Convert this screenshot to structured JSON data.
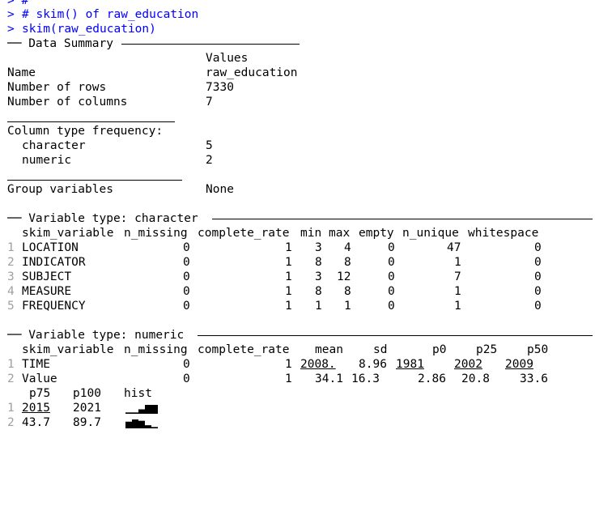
{
  "console": {
    "prompt": ">",
    "line0_partial": "> #",
    "comment": "# skim() of raw_education",
    "command": "skim(raw_education)"
  },
  "summary": {
    "header": "── Data Summary",
    "values_header": "Values",
    "rows": [
      {
        "label": "Name",
        "value": "raw_education"
      },
      {
        "label": "Number of rows",
        "value": "7330"
      },
      {
        "label": "Number of columns",
        "value": "7"
      }
    ],
    "col_type_title": "Column type frequency:",
    "col_types": [
      {
        "label": "character",
        "value": "5"
      },
      {
        "label": "numeric",
        "value": "2"
      }
    ],
    "group_label": "Group variables",
    "group_value": "None"
  },
  "character_section": {
    "header": "── Variable type: character",
    "columns": [
      "skim_variable",
      "n_missing",
      "complete_rate",
      "min",
      "max",
      "empty",
      "n_unique",
      "whitespace"
    ],
    "rows": [
      {
        "idx": "1",
        "skim_variable": "LOCATION",
        "n_missing": "0",
        "complete_rate": "1",
        "min": "3",
        "max": "4",
        "empty": "0",
        "n_unique": "47",
        "whitespace": "0"
      },
      {
        "idx": "2",
        "skim_variable": "INDICATOR",
        "n_missing": "0",
        "complete_rate": "1",
        "min": "8",
        "max": "8",
        "empty": "0",
        "n_unique": "1",
        "whitespace": "0"
      },
      {
        "idx": "3",
        "skim_variable": "SUBJECT",
        "n_missing": "0",
        "complete_rate": "1",
        "min": "3",
        "max": "12",
        "empty": "0",
        "n_unique": "7",
        "whitespace": "0"
      },
      {
        "idx": "4",
        "skim_variable": "MEASURE",
        "n_missing": "0",
        "complete_rate": "1",
        "min": "8",
        "max": "8",
        "empty": "0",
        "n_unique": "1",
        "whitespace": "0"
      },
      {
        "idx": "5",
        "skim_variable": "FREQUENCY",
        "n_missing": "0",
        "complete_rate": "1",
        "min": "1",
        "max": "1",
        "empty": "0",
        "n_unique": "1",
        "whitespace": "0"
      }
    ]
  },
  "numeric_section": {
    "header": "── Variable type: numeric",
    "columns": [
      "skim_variable",
      "n_missing",
      "complete_rate",
      "mean",
      "sd",
      "p0",
      "p25",
      "p50"
    ],
    "rows": [
      {
        "idx": "1",
        "skim_variable": "TIME",
        "n_missing": "0",
        "complete_rate": "1",
        "mean": "2008.",
        "sd": "8.96",
        "p0": "1981",
        "p25": "2002",
        "p50": "2009"
      },
      {
        "idx": "2",
        "skim_variable": "Value",
        "n_missing": "0",
        "complete_rate": "1",
        "mean": "34.1",
        "sd": "16.3",
        "p0": "2.86",
        "p25": "20.8",
        "p50": "33.6"
      }
    ],
    "columns_continued": [
      "p75",
      "p100",
      "hist"
    ],
    "rows_continued": [
      {
        "idx": "1",
        "p75": "2015",
        "p100": "2021",
        "hist_levels": [
          0.15,
          0.15,
          0.5,
          1.0,
          1.0
        ]
      },
      {
        "idx": "2",
        "p75": "43.7",
        "p100": "89.7",
        "hist_levels": [
          0.75,
          1.0,
          0.85,
          0.35,
          0.15
        ]
      }
    ]
  }
}
